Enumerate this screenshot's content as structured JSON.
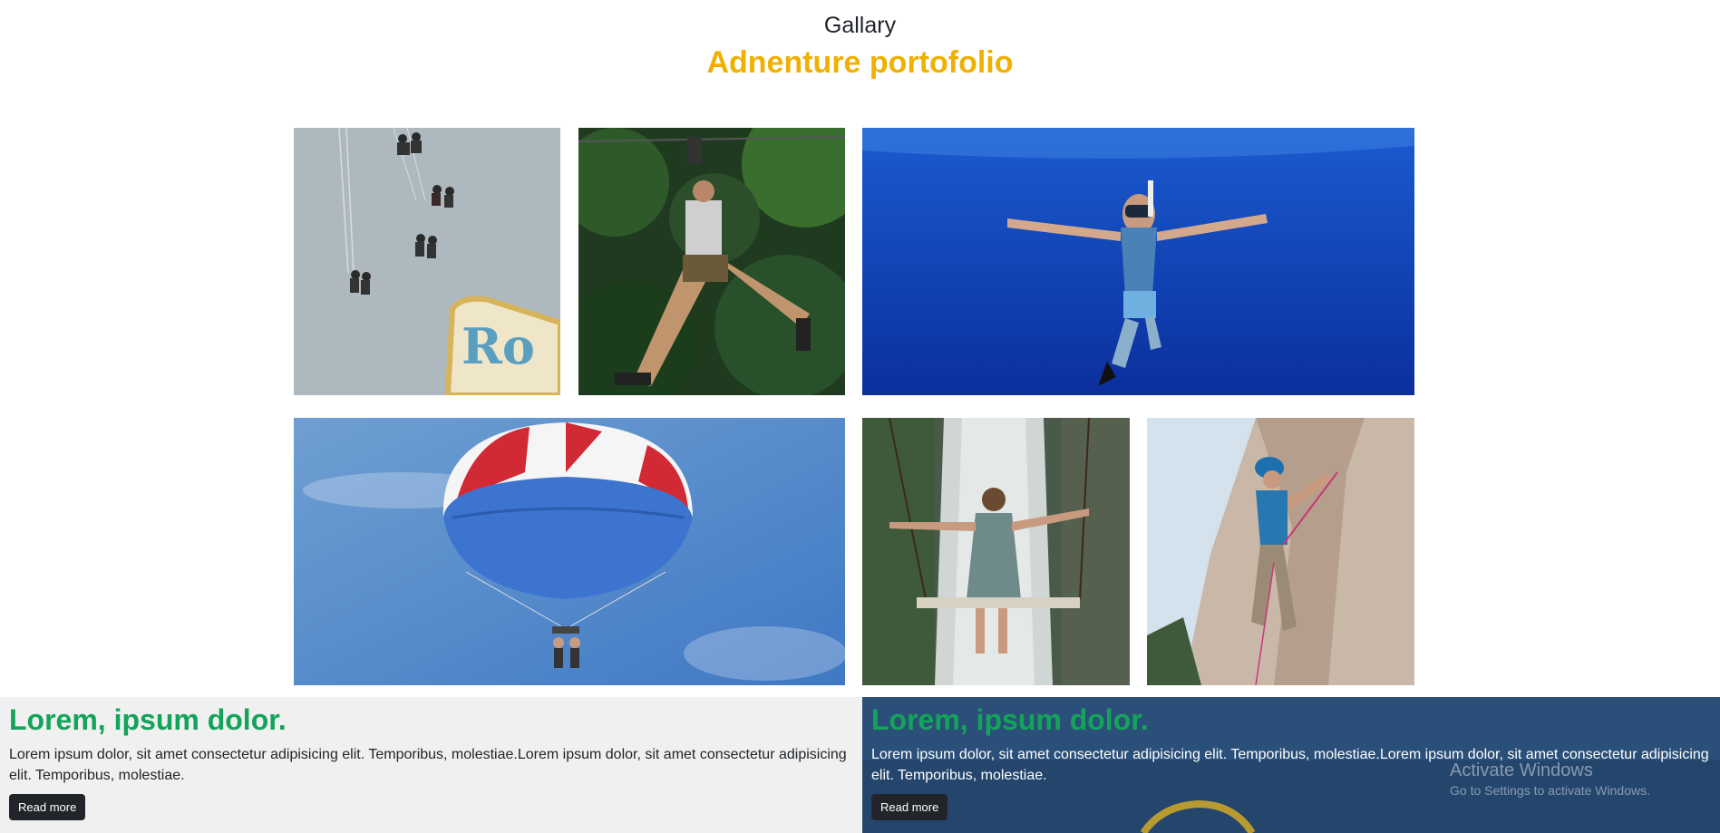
{
  "header": {
    "subtitle": "Gallary",
    "title": "Adnenture portofolio"
  },
  "gallery": {
    "photos": [
      {
        "label": "swing-ride-sky-photo"
      },
      {
        "label": "zipline-jungle-photo"
      },
      {
        "label": "snorkel-diver-photo"
      },
      {
        "label": "parasailing-photo"
      },
      {
        "label": "waterfall-swing-photo"
      },
      {
        "label": "rock-climber-photo"
      }
    ]
  },
  "cards": [
    {
      "heading": "Lorem, ipsum dolor.",
      "body": "Lorem ipsum dolor, sit amet consectetur adipisicing elit. Temporibus, molestiae.Lorem ipsum dolor, sit amet consectetur adipisicing elit. Temporibus, molestiae.",
      "button": "Read more"
    },
    {
      "heading": "Lorem, ipsum dolor.",
      "body": "Lorem ipsum dolor, sit amet consectetur adipisicing elit. Temporibus, molestiae.Lorem ipsum dolor, sit amet consectetur adipisicing elit. Temporibus, molestiae.",
      "button": "Read more"
    }
  ],
  "watermark": {
    "title": "Activate Windows",
    "subtitle": "Go to Settings to activate Windows."
  },
  "colors": {
    "accent_title": "#f0b000",
    "card_heading": "#14a35a",
    "button_bg": "#212529"
  }
}
